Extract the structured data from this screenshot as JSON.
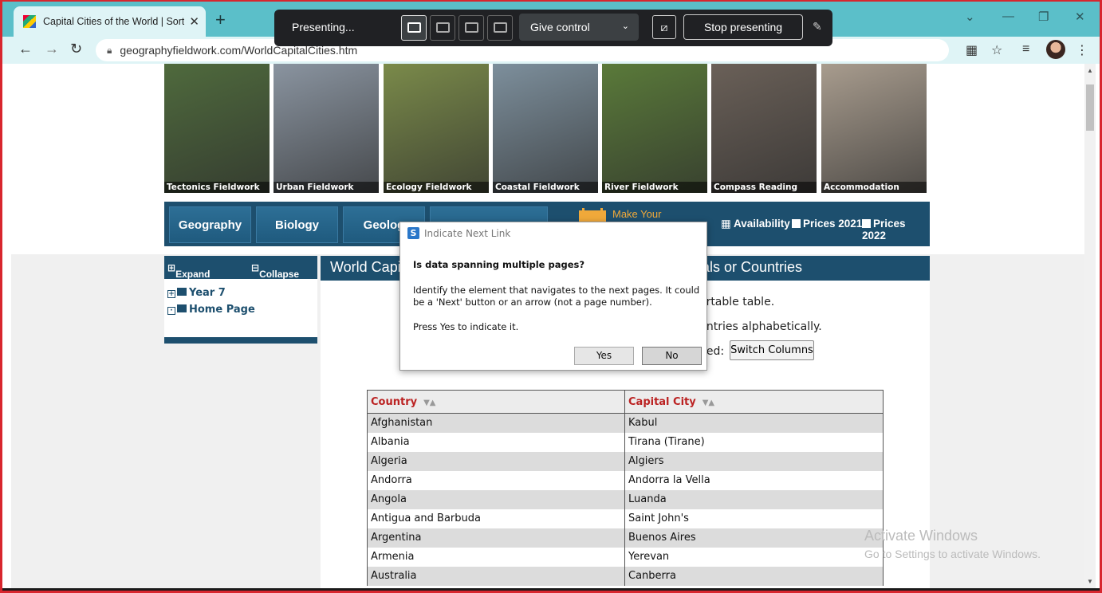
{
  "browser": {
    "tab_title": "Capital Cities of the World | Sortab",
    "url": "geographyfieldwork.com/WorldCapitalCities.htm"
  },
  "presenting": {
    "label": "Presenting...",
    "give_control": "Give control",
    "stop": "Stop presenting"
  },
  "photos": [
    {
      "caption": "Tectonics Fieldwork",
      "color": "#4f6a3d"
    },
    {
      "caption": "Urban Fieldwork",
      "color": "#8a94a0"
    },
    {
      "caption": "Ecology Fieldwork",
      "color": "#7a8a4a"
    },
    {
      "caption": "Coastal Fieldwork",
      "color": "#7d8f9c"
    },
    {
      "caption": "River Fieldwork",
      "color": "#5a7a3a"
    },
    {
      "caption": "Compass Reading",
      "color": "#6a6058"
    },
    {
      "caption": "Accommodation",
      "color": "#a89c8e"
    }
  ],
  "menu": {
    "tabs": [
      "Geography",
      "Biology",
      "Geolog"
    ],
    "make_your": "Make Your",
    "availability": "Availability",
    "prices_2021": "Prices 2021",
    "prices_2022": "Prices 2022"
  },
  "sidebar": {
    "expand_all": "Expand All",
    "collapse_all": "Collapse All",
    "items": [
      "Year 7",
      "Home Page"
    ]
  },
  "content": {
    "title_left": "World Capi",
    "title_right": "tals or Countries",
    "line1": "ortable table.",
    "line2": "untries alphabetically.",
    "line3": "hed:",
    "switch_button": "Switch Columns"
  },
  "table": {
    "headers": [
      "Country",
      "Capital City"
    ],
    "rows": [
      [
        "Afghanistan",
        "Kabul"
      ],
      [
        "Albania",
        "Tirana (Tirane)"
      ],
      [
        "Algeria",
        "Algiers"
      ],
      [
        "Andorra",
        "Andorra la Vella"
      ],
      [
        "Angola",
        "Luanda"
      ],
      [
        "Antigua and Barbuda",
        "Saint John's"
      ],
      [
        "Argentina",
        "Buenos Aires"
      ],
      [
        "Armenia",
        "Yerevan"
      ],
      [
        "Australia",
        "Canberra"
      ]
    ]
  },
  "dialog": {
    "title": "Indicate Next Link",
    "question": "Is data spanning multiple pages?",
    "body1": "Identify the element that navigates to the next pages. It could be a 'Next' button or an arrow (not a page number).",
    "body2": "Press Yes to indicate it.",
    "yes": "Yes",
    "no": "No"
  },
  "watermark": {
    "line1": "Activate Windows",
    "line2": "Go to Settings to activate Windows."
  },
  "colors": {
    "accent_navy": "#1d4f6e",
    "tabbar": "#5bbfc9",
    "header_red": "#b22222",
    "frame_red": "#d8262e"
  }
}
